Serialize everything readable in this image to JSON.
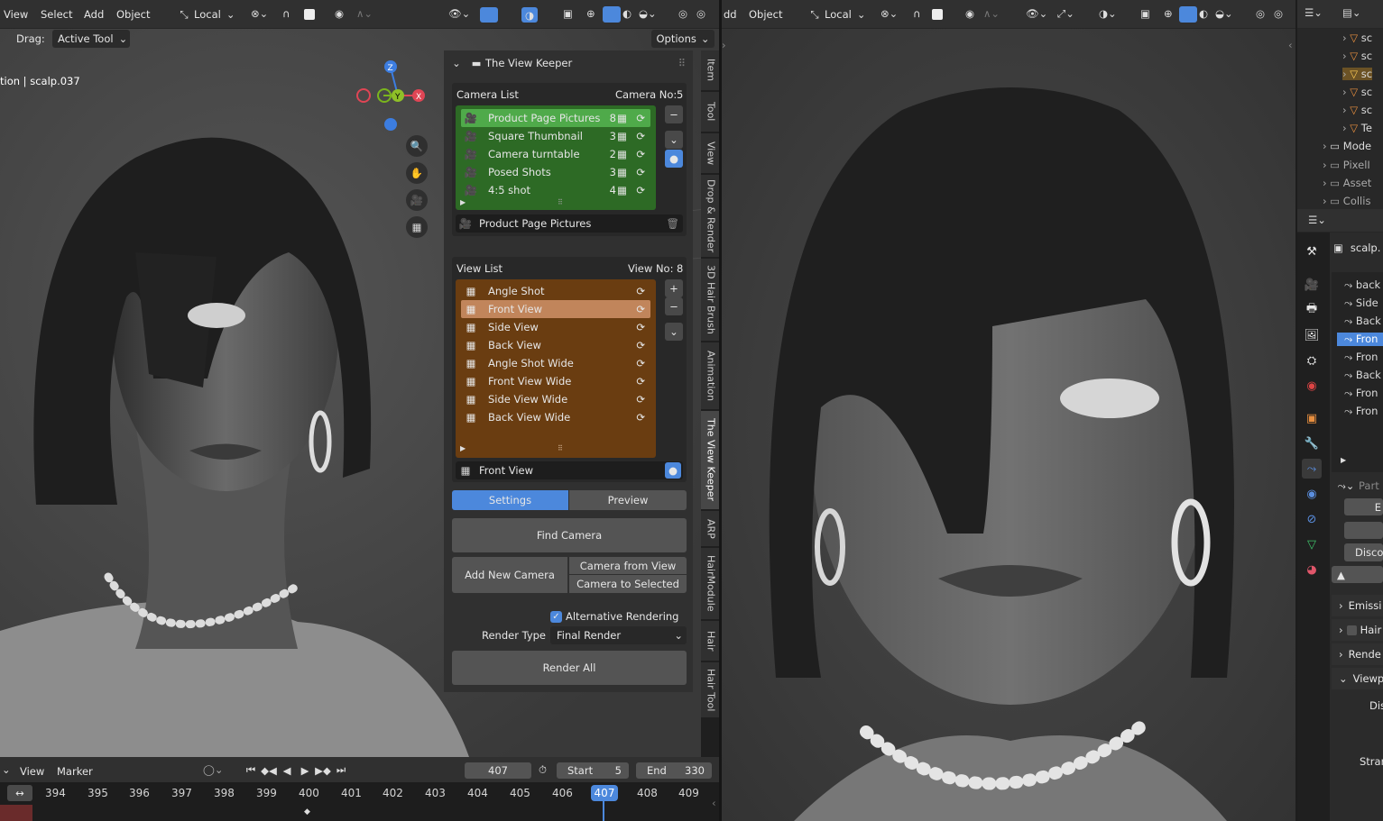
{
  "left_header": {
    "menu": [
      "View",
      "Select",
      "Add",
      "Object"
    ],
    "orientation": "Local"
  },
  "tool_header": {
    "drag_label": "Drag:",
    "drag_value": "Active Tool",
    "options": "Options"
  },
  "viewport_left": {
    "object_label": "tion | scalp.037"
  },
  "panel": {
    "title": "The View Keeper",
    "camera_list": {
      "label": "Camera List",
      "count_label": "Camera No:",
      "count": "5",
      "items": [
        {
          "name": "Product Page Pictures",
          "views": "8"
        },
        {
          "name": "Square Thumbnail",
          "views": "3"
        },
        {
          "name": "Camera turntable",
          "views": "2"
        },
        {
          "name": "Posed Shots",
          "views": "3"
        },
        {
          "name": "4:5 shot",
          "views": "4"
        }
      ],
      "active_name": "Product Page Pictures"
    },
    "view_list": {
      "label": "View List",
      "count_label": "View No:",
      "count": "8",
      "items": [
        "Angle Shot",
        "Front View",
        "Side View",
        "Back View",
        "Angle Shot Wide",
        "Front View Wide",
        "Side View Wide",
        "Back View Wide"
      ],
      "active_name": "Front View"
    },
    "tabs": {
      "settings": "Settings",
      "preview": "Preview"
    },
    "find_camera": "Find Camera",
    "add_new_camera": "Add New Camera",
    "camera_from_view": "Camera from View",
    "camera_to_selected": "Camera to Selected",
    "alt_rendering": "Alternative Rendering",
    "render_type_label": "Render Type",
    "render_type_value": "Final Render",
    "render_all": "Render All"
  },
  "sidebar_tabs": [
    "Item",
    "Tool",
    "View",
    "Drop & Render",
    "3D Hair Brush",
    "Animation",
    "The View Keeper",
    "ARP",
    "HairModule",
    "Hair",
    "Hair Tool"
  ],
  "timeline": {
    "view": "View",
    "marker": "Marker",
    "frame": "407",
    "start_label": "Start",
    "start": "5",
    "end_label": "End",
    "end": "330",
    "ticks": [
      "394",
      "395",
      "396",
      "397",
      "398",
      "399",
      "400",
      "401",
      "402",
      "403",
      "404",
      "405",
      "406",
      "407",
      "408",
      "409"
    ]
  },
  "right_header": {
    "menu": [
      "dd",
      "Object"
    ],
    "orientation": "Local"
  },
  "outliner": {
    "rows": [
      "sc",
      "sc",
      "sc",
      "sc",
      "sc",
      "Te",
      "Mode",
      "PixelI",
      "Asset",
      "Collis"
    ]
  },
  "properties": {
    "object": "scalp.",
    "rows": [
      "back",
      "Side",
      "Back",
      "Fron",
      "Fron",
      "Back",
      "Fron",
      "Fron"
    ],
    "particles": "Part",
    "sections": [
      "E",
      "Disco",
      "Emissi",
      "Hair",
      "Rende",
      "Viewpo",
      "Dis",
      "Stran"
    ]
  },
  "colors": {
    "camera_list_bg": "#2d6a25",
    "camera_active": "#4faa4a",
    "view_list_bg": "#6a3d11",
    "view_active": "#c1855b",
    "accent": "#4c88dc"
  }
}
